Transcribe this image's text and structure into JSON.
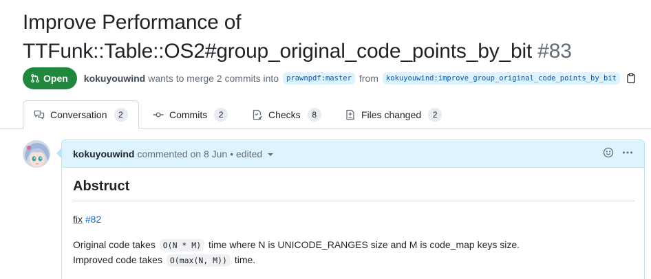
{
  "pr": {
    "title_line1": "Improve Performance of",
    "title_line2": "TTFunk::Table::OS2#group_original_code_points_by_bit",
    "number": "#83",
    "state": "Open",
    "author": "kokuyouwind",
    "merge_text": "wants to merge 2 commits into",
    "base_branch": "prawnpdf:master",
    "from_text": "from",
    "head_branch": "kokuyouwind:improve_group_original_code_points_by_bit",
    "state_color": "#1f883d"
  },
  "tabs": [
    {
      "label": "Conversation",
      "count": "2",
      "icon": "comment-discussion-icon"
    },
    {
      "label": "Commits",
      "count": "2",
      "icon": "git-commit-icon"
    },
    {
      "label": "Checks",
      "count": "8",
      "icon": "checklist-icon"
    },
    {
      "label": "Files changed",
      "count": "2",
      "icon": "file-diff-icon"
    }
  ],
  "comment": {
    "author": "kokuyouwind",
    "meta": "commented on 8 Jun",
    "edited": "• edited",
    "heading": "Abstruct",
    "fix_word": "fix",
    "issue_ref": "#82",
    "line1_a": "Original code takes",
    "line1_code": "O(N * M)",
    "line1_b": "time where N is UNICODE_RANGES size and M is code_map keys size.",
    "line2_a": "Improved code takes",
    "line2_code": "O(max(N, M))",
    "line2_b": "time."
  }
}
